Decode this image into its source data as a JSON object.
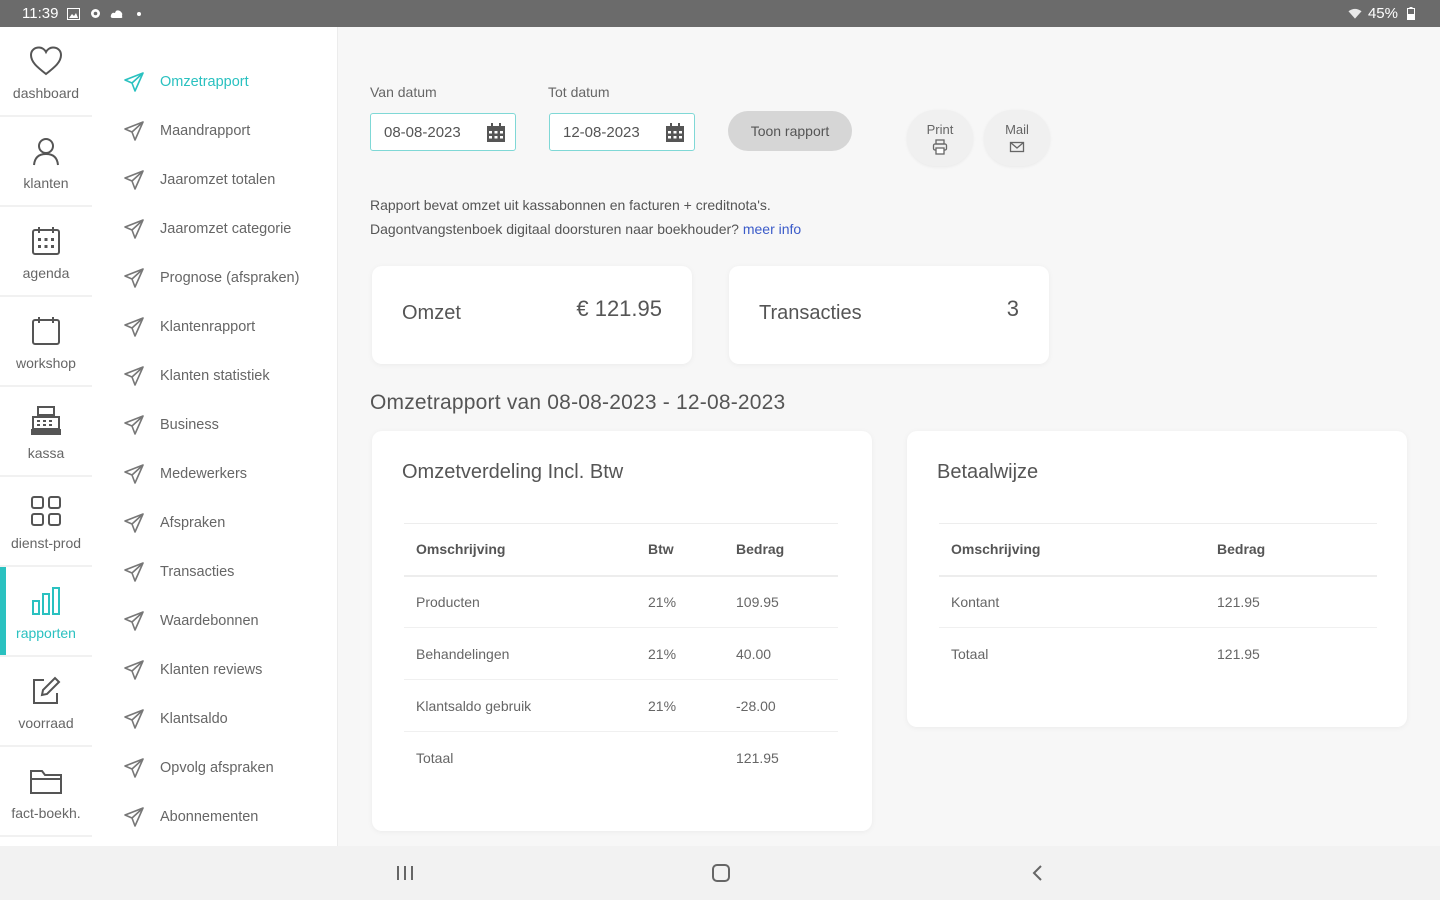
{
  "status_bar": {
    "time": "11:39",
    "battery": "45%"
  },
  "rail": [
    {
      "label": "dashboard",
      "icon": "heart-icon",
      "active": false
    },
    {
      "label": "klanten",
      "icon": "user-icon",
      "active": false
    },
    {
      "label": "agenda",
      "icon": "calendar-icon",
      "active": false
    },
    {
      "label": "workshop",
      "icon": "calendar-blank-icon",
      "active": false
    },
    {
      "label": "kassa",
      "icon": "cash-register-icon",
      "active": false
    },
    {
      "label": "dienst-prod",
      "icon": "grid-icon",
      "active": false
    },
    {
      "label": "rapporten",
      "icon": "bar-chart-icon",
      "active": true
    },
    {
      "label": "voorraad",
      "icon": "edit-icon",
      "active": false
    },
    {
      "label": "fact-boekh.",
      "icon": "folder-icon",
      "active": false
    }
  ],
  "submenu": [
    "Omzetrapport",
    "Maandrapport",
    "Jaaromzet totalen",
    "Jaaromzet categorie",
    "Prognose (afspraken)",
    "Klantenrapport",
    "Klanten statistiek",
    "Business",
    "Medewerkers",
    "Afspraken",
    "Transacties",
    "Waardebonnen",
    "Klanten reviews",
    "Klantsaldo",
    "Opvolg afspraken",
    "Abonnementen"
  ],
  "filters": {
    "from_label": "Van datum",
    "from_value": "08-08-2023",
    "to_label": "Tot datum",
    "to_value": "12-08-2023",
    "show_button": "Toon rapport",
    "print_label": "Print",
    "mail_label": "Mail"
  },
  "info": {
    "line1": "Rapport bevat omzet uit kassabonnen en facturen + creditnota's.",
    "line2": "Dagontvangstenboek digitaal doorsturen naar boekhouder?",
    "link": "meer info"
  },
  "stats": {
    "omzet_label": "Omzet",
    "omzet_value": "€ 121.95",
    "transacties_label": "Transacties",
    "transacties_value": "3"
  },
  "report_title": "Omzetrapport van 08-08-2023 - 12-08-2023",
  "omzetverdeling": {
    "title": "Omzetverdeling Incl. Btw",
    "headers": [
      "Omschrijving",
      "Btw",
      "Bedrag"
    ],
    "rows": [
      [
        "Producten",
        "21%",
        "109.95"
      ],
      [
        "Behandelingen",
        "21%",
        "40.00"
      ],
      [
        "Klantsaldo gebruik",
        "21%",
        "-28.00"
      ],
      [
        "Totaal",
        "",
        "121.95"
      ]
    ]
  },
  "betaalwijze": {
    "title": "Betaalwijze",
    "headers": [
      "Omschrijving",
      "Bedrag"
    ],
    "rows": [
      [
        "Kontant",
        "121.95"
      ],
      [
        "Totaal",
        "121.95"
      ]
    ]
  },
  "colors": {
    "accent": "#2ac1c0",
    "link": "#3b5bc9"
  }
}
